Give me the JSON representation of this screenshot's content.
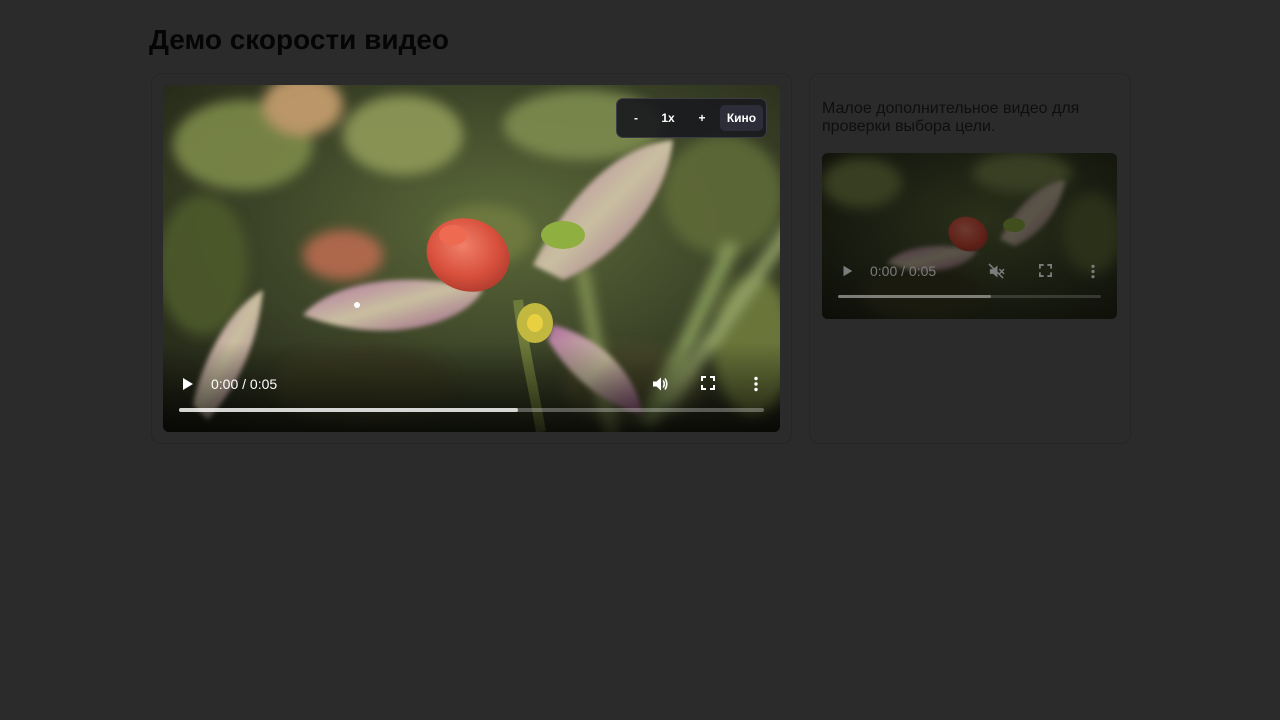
{
  "page": {
    "title": "Демо скорости видео"
  },
  "main_video": {
    "time": "0:00 / 0:05",
    "progress_fraction": 0.58,
    "icons": {
      "play": "play-icon",
      "volume": "volume-icon",
      "fullscreen": "fullscreen-icon",
      "more": "more-options-icon"
    }
  },
  "speed_controls": {
    "decrease_label": "-",
    "rate_label": "1x",
    "increase_label": "+",
    "cinema_label": "Кино"
  },
  "side_panel": {
    "description": "Малое дополнительное видео для проверки выбора цели.",
    "video": {
      "time": "0:00 / 0:05",
      "progress_fraction": 0.58,
      "icons": {
        "play": "play-icon",
        "muted": "volume-muted-icon",
        "fullscreen": "fullscreen-icon",
        "more": "more-options-icon"
      }
    }
  },
  "colors": {
    "page_background": "#2b2b2b",
    "title_text": "#050505",
    "speed_panel_background": "#1a1a1e",
    "speed_active_background": "#2c2d38"
  }
}
